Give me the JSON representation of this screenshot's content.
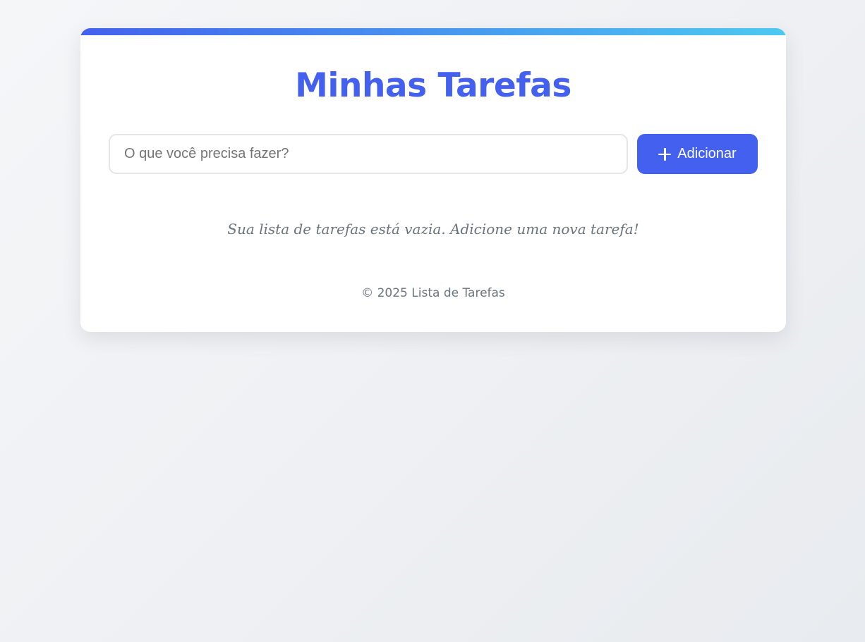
{
  "app": {
    "title": "Minhas Tarefas"
  },
  "form": {
    "input_value": "",
    "input_placeholder": "O que você precisa fazer?",
    "add_label": "Adicionar"
  },
  "list": {
    "items": [],
    "empty_message": "Sua lista de tarefas está vazia. Adicione uma nova tarefa!"
  },
  "footer": {
    "text": "© 2025 Lista de Tarefas"
  },
  "icons": {
    "add": "plus-icon"
  },
  "colors": {
    "accent": "#4361ee",
    "accent_gradient_end": "#4cc9f0",
    "muted_text": "#6c757d"
  }
}
